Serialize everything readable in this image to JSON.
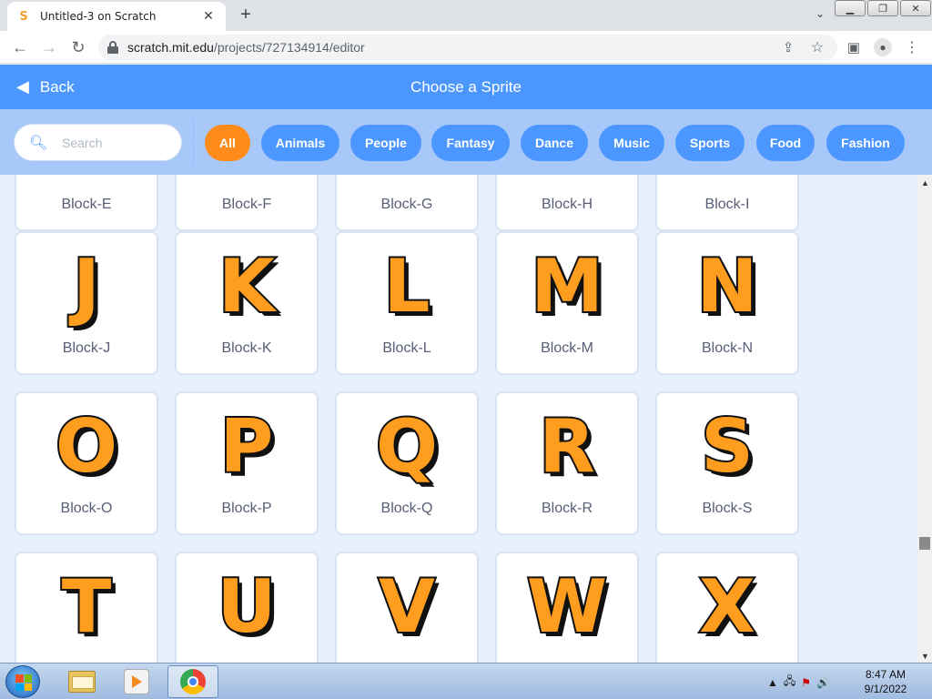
{
  "browser": {
    "tab_title": "Untitled-3 on Scratch",
    "tab_close": "✕",
    "new_tab": "+",
    "url_host": "scratch.mit.edu",
    "url_path": "/projects/727134914/editor"
  },
  "header": {
    "back_label": "Back",
    "title": "Choose a Sprite"
  },
  "search": {
    "placeholder": "Search"
  },
  "categories": [
    "All",
    "Animals",
    "People",
    "Fantasy",
    "Dance",
    "Music",
    "Sports",
    "Food",
    "Fashion"
  ],
  "active_category": "All",
  "sprites": [
    {
      "letter": "",
      "label": "Block-E"
    },
    {
      "letter": "",
      "label": "Block-F"
    },
    {
      "letter": "",
      "label": "Block-G"
    },
    {
      "letter": "",
      "label": "Block-H"
    },
    {
      "letter": "",
      "label": "Block-I"
    },
    {
      "letter": "J",
      "label": "Block-J"
    },
    {
      "letter": "K",
      "label": "Block-K"
    },
    {
      "letter": "L",
      "label": "Block-L"
    },
    {
      "letter": "M",
      "label": "Block-M"
    },
    {
      "letter": "N",
      "label": "Block-N"
    },
    {
      "letter": "O",
      "label": "Block-O"
    },
    {
      "letter": "P",
      "label": "Block-P"
    },
    {
      "letter": "Q",
      "label": "Block-Q"
    },
    {
      "letter": "R",
      "label": "Block-R"
    },
    {
      "letter": "S",
      "label": "Block-S"
    },
    {
      "letter": "T",
      "label": ""
    },
    {
      "letter": "U",
      "label": ""
    },
    {
      "letter": "V",
      "label": ""
    },
    {
      "letter": "W",
      "label": ""
    },
    {
      "letter": "X",
      "label": ""
    }
  ],
  "taskbar": {
    "time": "8:47 AM",
    "date": "9/1/2022"
  },
  "colors": {
    "scratch_blue": "#4c97ff",
    "active_orange": "#ff8c1a",
    "letter_fill": "#ff9d1e"
  }
}
